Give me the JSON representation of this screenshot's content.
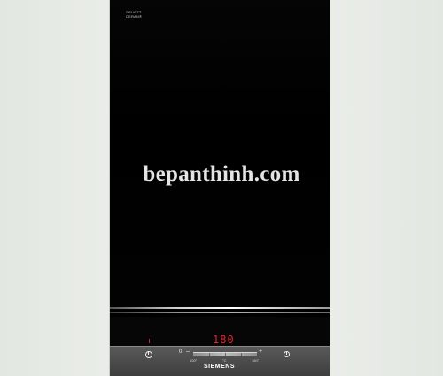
{
  "product": {
    "glass_logo_line1": "SCHOTT",
    "glass_logo_line2": "CERAN®",
    "temperature_display": "180",
    "brand": "SIEMENS",
    "controls": {
      "zero": "0",
      "minus": "–",
      "plus": "+",
      "scale_min": "100°",
      "scale_mid": "°C",
      "scale_max": "160°"
    },
    "colors": {
      "glass": "#000000",
      "display_red": "#e3222c",
      "control_bar": "#4a4a4a",
      "background": "#e9ece8"
    },
    "icons": [
      "power-icon",
      "timer-icon"
    ]
  },
  "watermark": {
    "text": "bepanthinh.com"
  }
}
